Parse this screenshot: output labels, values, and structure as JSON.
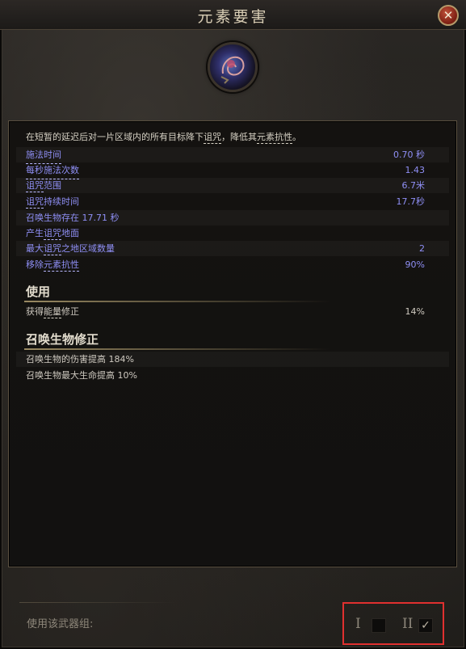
{
  "window": {
    "title": "元素要害",
    "close_label": "✕"
  },
  "skill": {
    "icon": "curse-skill-icon"
  },
  "description": {
    "prefix": "在短暂的延迟后对一片区域内的所有目标降下",
    "kw1": "诅咒",
    "mid": "，降低其",
    "kw2": "元素抗性",
    "suffix": "。"
  },
  "stats": [
    {
      "label": "施法时间",
      "value": "0.70 秒"
    },
    {
      "label": "每秒施法次数",
      "value": "1.43"
    },
    {
      "label_pre": "",
      "label_kw": "诅咒",
      "label_post": "范围",
      "value": "6.7米"
    },
    {
      "label_pre": "",
      "label_kw": "诅咒",
      "label_post": "持续时间",
      "value": "17.7秒"
    },
    {
      "label": "召唤生物存在 17.71 秒",
      "value": ""
    },
    {
      "label_pre": "产生",
      "label_kw": "诅咒",
      "label_post": "地面",
      "value": ""
    },
    {
      "label_pre": "最大",
      "label_kw": "诅咒",
      "label_post": "之地区域数量",
      "value": "2"
    },
    {
      "label_pre": "移除",
      "label_kw": "元素抗性",
      "label_post": "",
      "value": "90%"
    }
  ],
  "usage": {
    "heading": "使用",
    "row_pre": "获得",
    "row_kw": "能量",
    "row_post": "修正",
    "row_value": "14%"
  },
  "minion": {
    "heading": "召唤生物修正",
    "rows": [
      "召唤生物的伤害提高 184%",
      "召唤生物最大生命提高 10%"
    ]
  },
  "weapon_set": {
    "label": "使用该武器组:",
    "set1_numeral": "I",
    "set2_numeral": "II",
    "set1_checked": false,
    "set2_checked": true,
    "check_glyph": "✓"
  },
  "colors": {
    "stat_text": "#8f8ff5",
    "highlight_box": "#e0302f",
    "close_button": "#9a2a1a"
  }
}
